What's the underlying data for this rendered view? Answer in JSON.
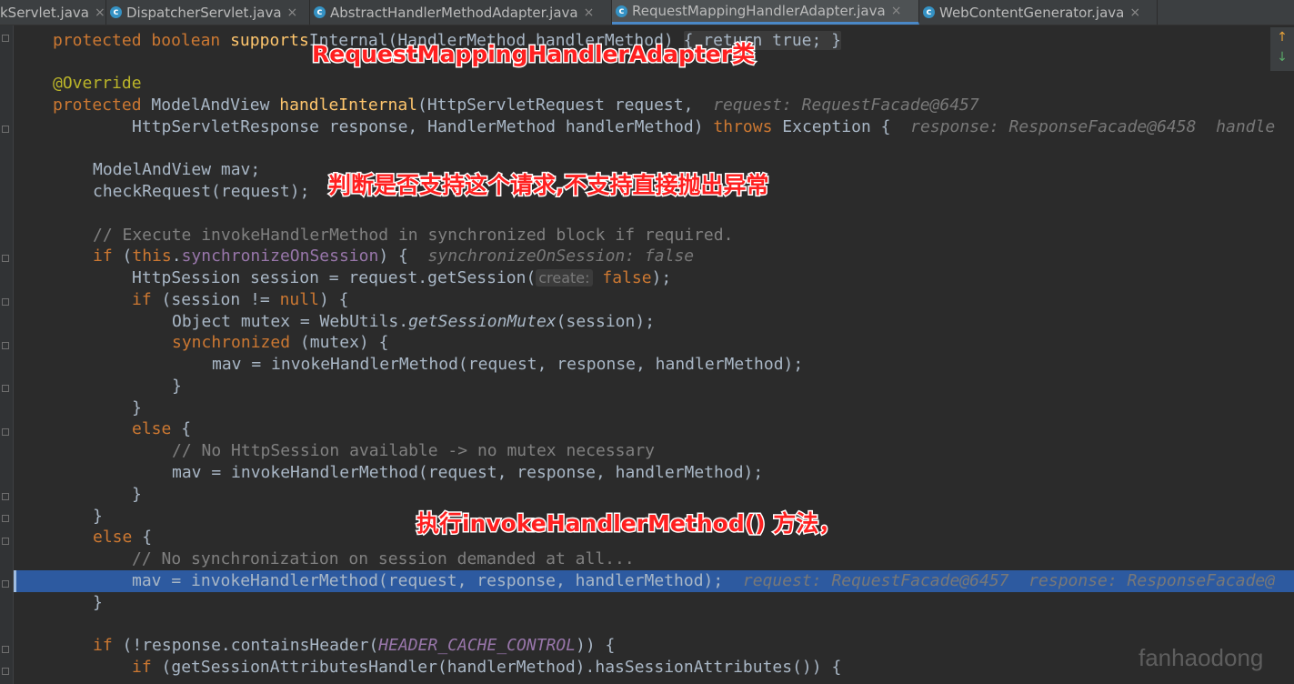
{
  "tabs": [
    {
      "label": "kServlet.java",
      "active": false,
      "icon": "class-icon"
    },
    {
      "label": "DispatcherServlet.java",
      "active": false,
      "icon": "class-icon"
    },
    {
      "label": "AbstractHandlerMethodAdapter.java",
      "active": false,
      "icon": "class-icon"
    },
    {
      "label": "RequestMappingHandlerAdapter.java",
      "active": true,
      "icon": "class-icon"
    },
    {
      "label": "WebContentGenerator.java",
      "active": false,
      "icon": "class-icon"
    }
  ],
  "tab_close_glyph": "×",
  "code": {
    "kw_protected": "protected",
    "kw_boolean": "boolean",
    "fn_supports_partial": "supports",
    "hidden_partial": "Internal(HandlerMethod handlerMethod)",
    "folded_body": "{ return true; }",
    "annotation_override": "@Override",
    "type_mav": "ModelAndView",
    "fn_handleInternal": "handleInternal",
    "param1": "(HttpServletRequest request,",
    "hint_request": "request: RequestFacade@6457",
    "param2a": "HttpServletResponse response, HandlerMethod handlerMethod)",
    "kw_throws": "throws",
    "param2b": "Exception {",
    "hint_response": "response: ResponseFacade@6458",
    "hint_handler_partial": "handle",
    "decl_mav": "ModelAndView mav;",
    "check_request": "checkRequest(request);",
    "comment_execute": "// Execute invokeHandlerMethod in synchronized block if required.",
    "kw_if": "if",
    "kw_this": "this",
    "field_sync": "synchronizeOnSession",
    "hint_sync": "synchronizeOnSession: false",
    "session_decl": "HttpSession session = request.getSession(",
    "param_hint_create": "create:",
    "kw_false": "false",
    "kw_null": "null",
    "session_null_check": "(session != ",
    "object_mutex": "Object mutex = WebUtils.",
    "fn_getSessionMutex": "getSessionMutex",
    "kw_synchronized": "synchronized",
    "mutex_arg": "(mutex) {",
    "mav_assign": "mav = invokeHandlerMethod(request, response, handlerMethod);",
    "kw_else": "else",
    "comment_no_session": "// No HttpSession available -> no mutex necessary",
    "comment_no_sync": "// No synchronization on session demanded at all...",
    "hint_request_response": "request: RequestFacade@6457  response: ResponseFacade@",
    "contains_header": "(!response.containsHeader(",
    "const_cache": "HEADER_CACHE_CONTROL",
    "session_attrs": "(getSessionAttributesHandler(handlerMethod).hasSessionAttributes()) {"
  },
  "annotations": {
    "class_note": "RequestMappingHandlerAdapter类",
    "check_note": "判断是否支持这个请求,不支持直接抛出异常",
    "invoke_note": "执行invokeHandlerMethod() 方法，"
  },
  "nav_arrows": {
    "up": "↑",
    "down": "↓",
    "up_color": "#E8A33A",
    "down_color": "#59A869"
  },
  "watermark": "fanhaodong",
  "colors": {
    "background": "#2B2B2B",
    "keyword": "#CC7832",
    "method": "#FFC66D",
    "highlight": "#2D5AA0",
    "annotation_red": "#FF2020"
  }
}
